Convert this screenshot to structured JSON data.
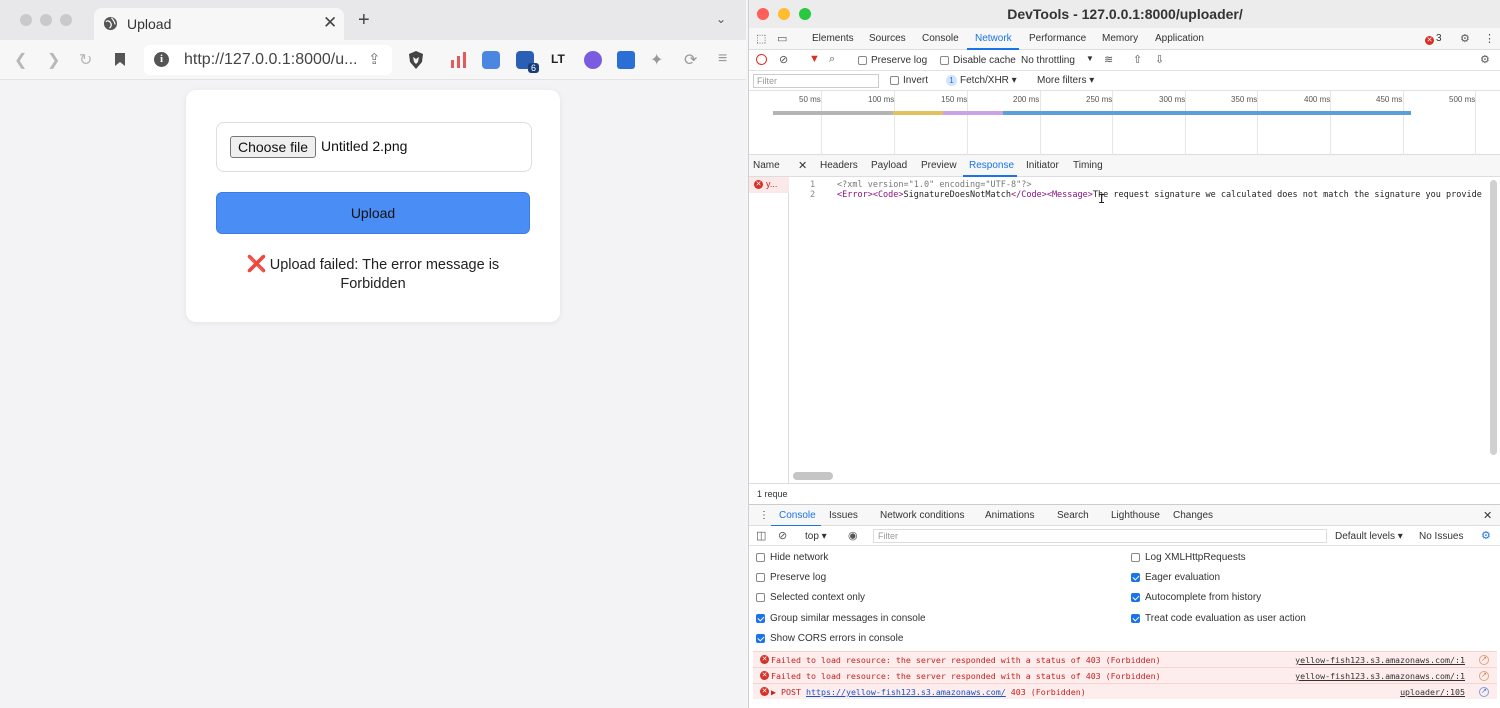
{
  "browser": {
    "tab": {
      "title": "Upload"
    },
    "address": {
      "url": "http://127.0.0.1:8000/u..."
    },
    "extension_badge": "6",
    "page": {
      "file_button": "Choose file",
      "file_name": "Untitled 2.png",
      "upload_button": "Upload",
      "error_prefix": "❌",
      "error_message": "Upload failed: The error message is Forbidden"
    }
  },
  "devtools": {
    "title": "DevTools - 127.0.0.1:8000/uploader/",
    "main_tabs": [
      "Elements",
      "Sources",
      "Console",
      "Network",
      "Performance",
      "Memory",
      "Application"
    ],
    "active_main_tab": "Network",
    "error_count": "3",
    "toolbar": {
      "preserve_log": "Preserve log",
      "disable_cache": "Disable cache",
      "throttling": "No throttling"
    },
    "filter_bar": {
      "filter_placeholder": "Filter",
      "invert": "Invert",
      "type_count": "1",
      "type_filter": "Fetch/XHR",
      "more_filters": "More filters"
    },
    "timeline_ticks": [
      "50 ms",
      "100 ms",
      "150 ms",
      "200 ms",
      "250 ms",
      "300 ms",
      "350 ms",
      "400 ms",
      "450 ms",
      "500 ms"
    ],
    "detail_tabs": [
      "Headers",
      "Payload",
      "Preview",
      "Response",
      "Initiator",
      "Timing"
    ],
    "active_detail_tab": "Response",
    "name_header": "Name",
    "request_name": "y...",
    "response": {
      "line1_no": "1",
      "line2_no": "2",
      "line1": "<?xml version=\"1.0\" encoding=\"UTF-8\"?>",
      "line2_tags": "<Error><Code>",
      "line2_code": "SignatureDoesNotMatch",
      "line2_close": "</Code><Message>",
      "line2_text": "The request signature we calculated does not match the signature you provide"
    },
    "status_text": "1 reque",
    "drawer_tabs": [
      "Console",
      "Issues",
      "Network conditions",
      "Animations",
      "Search",
      "Lighthouse",
      "Changes"
    ],
    "console_toolbar": {
      "context": "top",
      "filter_placeholder": "Filter",
      "levels": "Default levels",
      "issues": "No Issues"
    },
    "settings_left": [
      {
        "label": "Hide network",
        "checked": false
      },
      {
        "label": "Preserve log",
        "checked": false
      },
      {
        "label": "Selected context only",
        "checked": false
      },
      {
        "label": "Group similar messages in console",
        "checked": true
      },
      {
        "label": "Show CORS errors in console",
        "checked": true
      }
    ],
    "settings_right": [
      {
        "label": "Log XMLHttpRequests",
        "checked": false
      },
      {
        "label": "Eager evaluation",
        "checked": true
      },
      {
        "label": "Autocomplete from history",
        "checked": true
      },
      {
        "label": "Treat code evaluation as user action",
        "checked": true
      }
    ],
    "console_errors": [
      {
        "message": "Failed to load resource: the server responded with a status of 403 (Forbidden)",
        "source": "yellow-fish123.s3.amazonaws.com/:1"
      },
      {
        "message": "Failed to load resource: the server responded with a status of 403 (Forbidden)",
        "source": "yellow-fish123.s3.amazonaws.com/:1"
      }
    ],
    "post_error": {
      "method": "▶ POST",
      "url": "https://yellow-fish123.s3.amazonaws.com/",
      "status": "403 (Forbidden)",
      "source": "uploader/:105"
    },
    "colors": {
      "accent": "#1a73e8",
      "error": "#d93025",
      "upload_button": "#4a8ef5"
    }
  }
}
